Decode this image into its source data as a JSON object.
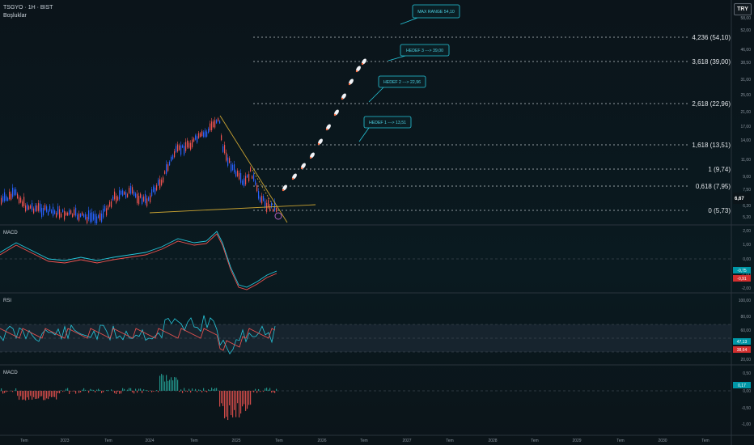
{
  "header": {
    "symbol_line": "TSGYO · 1H · BIST",
    "indicator_name": "Boşluklar",
    "currency_button": "TRY"
  },
  "colors": {
    "background": "#0b1419",
    "bull": "#2962ff",
    "bear": "#ef5350",
    "callout_border": "#26c6da",
    "callout_text": "#4dd0e1",
    "trendline": "#c8a232",
    "macd_line": "#26c6da",
    "signal_line": "#ef5350",
    "rsi_line": "#26c6da",
    "rsi_ma": "#ef5350",
    "hist_up": "#26a69a",
    "hist_down": "#ef5350"
  },
  "price_axis": {
    "ticks": [
      "58,00",
      "52,00",
      "46,00",
      "38,50",
      "31,00",
      "25,00",
      "21,00",
      "17,00",
      "14,00",
      "11,00",
      "9,00",
      "7,50",
      "6,20",
      "5,20"
    ],
    "current_price": "6,67"
  },
  "fib_levels": [
    {
      "label": "4,236 (54,10)"
    },
    {
      "label": "3,618 (39,00)"
    },
    {
      "label": "2,618 (22,96)"
    },
    {
      "label": "1,618 (13,51)"
    },
    {
      "label": "1 (9,74)"
    },
    {
      "label": "0,618 (7,95)"
    },
    {
      "label": "0 (5,73)"
    }
  ],
  "callouts": [
    {
      "text": "MAX RANGE 54,10"
    },
    {
      "text": "HEDEF 3 ---> 39,00"
    },
    {
      "text": "HEDEF 2 ---> 22,96"
    },
    {
      "text": "HEDEF 1 ---> 13,51"
    }
  ],
  "macd_panel": {
    "title": "MACD",
    "ticks": [
      "2,00",
      "1,00",
      "0,00",
      "-1,00",
      "-2,00"
    ],
    "macd_value": "-0,75",
    "signal_value": "-0,91"
  },
  "rsi_panel": {
    "title": "RSI",
    "ticks": [
      "100,00",
      "80,00",
      "60,00",
      "20,00"
    ],
    "rsi_value": "47,13",
    "ma_value": "38,64"
  },
  "hist_panel": {
    "title": "MACD",
    "ticks": [
      "0,50",
      "0,00",
      "-0,50",
      "-1,00"
    ],
    "value": "0,17"
  },
  "time_axis": [
    "Tem",
    "2023",
    "Tem",
    "2024",
    "Tem",
    "2025",
    "Tem",
    "2026",
    "Tem",
    "2027",
    "Tem",
    "2028",
    "Tem",
    "2029",
    "Tem",
    "2030",
    "Tem"
  ]
}
